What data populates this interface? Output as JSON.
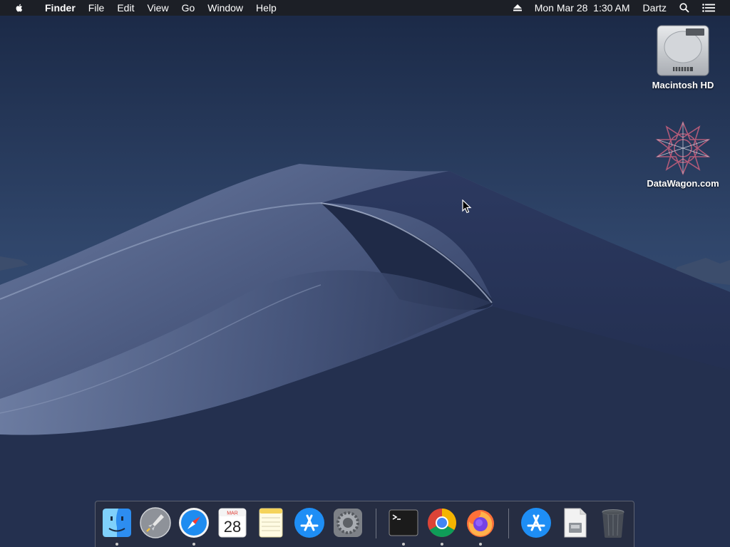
{
  "menubar": {
    "app_name": "Finder",
    "menus": [
      "File",
      "Edit",
      "View",
      "Go",
      "Window",
      "Help"
    ],
    "clock": "Mon Mar 28  1:30 AM",
    "user": "Dartz"
  },
  "desktop": {
    "icons": [
      {
        "label": "Macintosh HD",
        "icon": "hard-drive-icon"
      },
      {
        "label": "DataWagon.com",
        "icon": "geometric-star-icon"
      }
    ]
  },
  "dock": {
    "calendar": {
      "month": "MAR",
      "day": "28"
    },
    "apps": [
      "finder",
      "launchpad",
      "safari",
      "calendar",
      "notes",
      "app-store",
      "system-preferences",
      "terminal",
      "chrome",
      "firefox",
      "app-store-downloads",
      "disk-image",
      "trash"
    ]
  },
  "colors": {
    "menubar_bg": "#1c1e24",
    "sky_top": "#1b2a47",
    "sky_bottom": "#3a5174",
    "dune": "#2a3658"
  }
}
